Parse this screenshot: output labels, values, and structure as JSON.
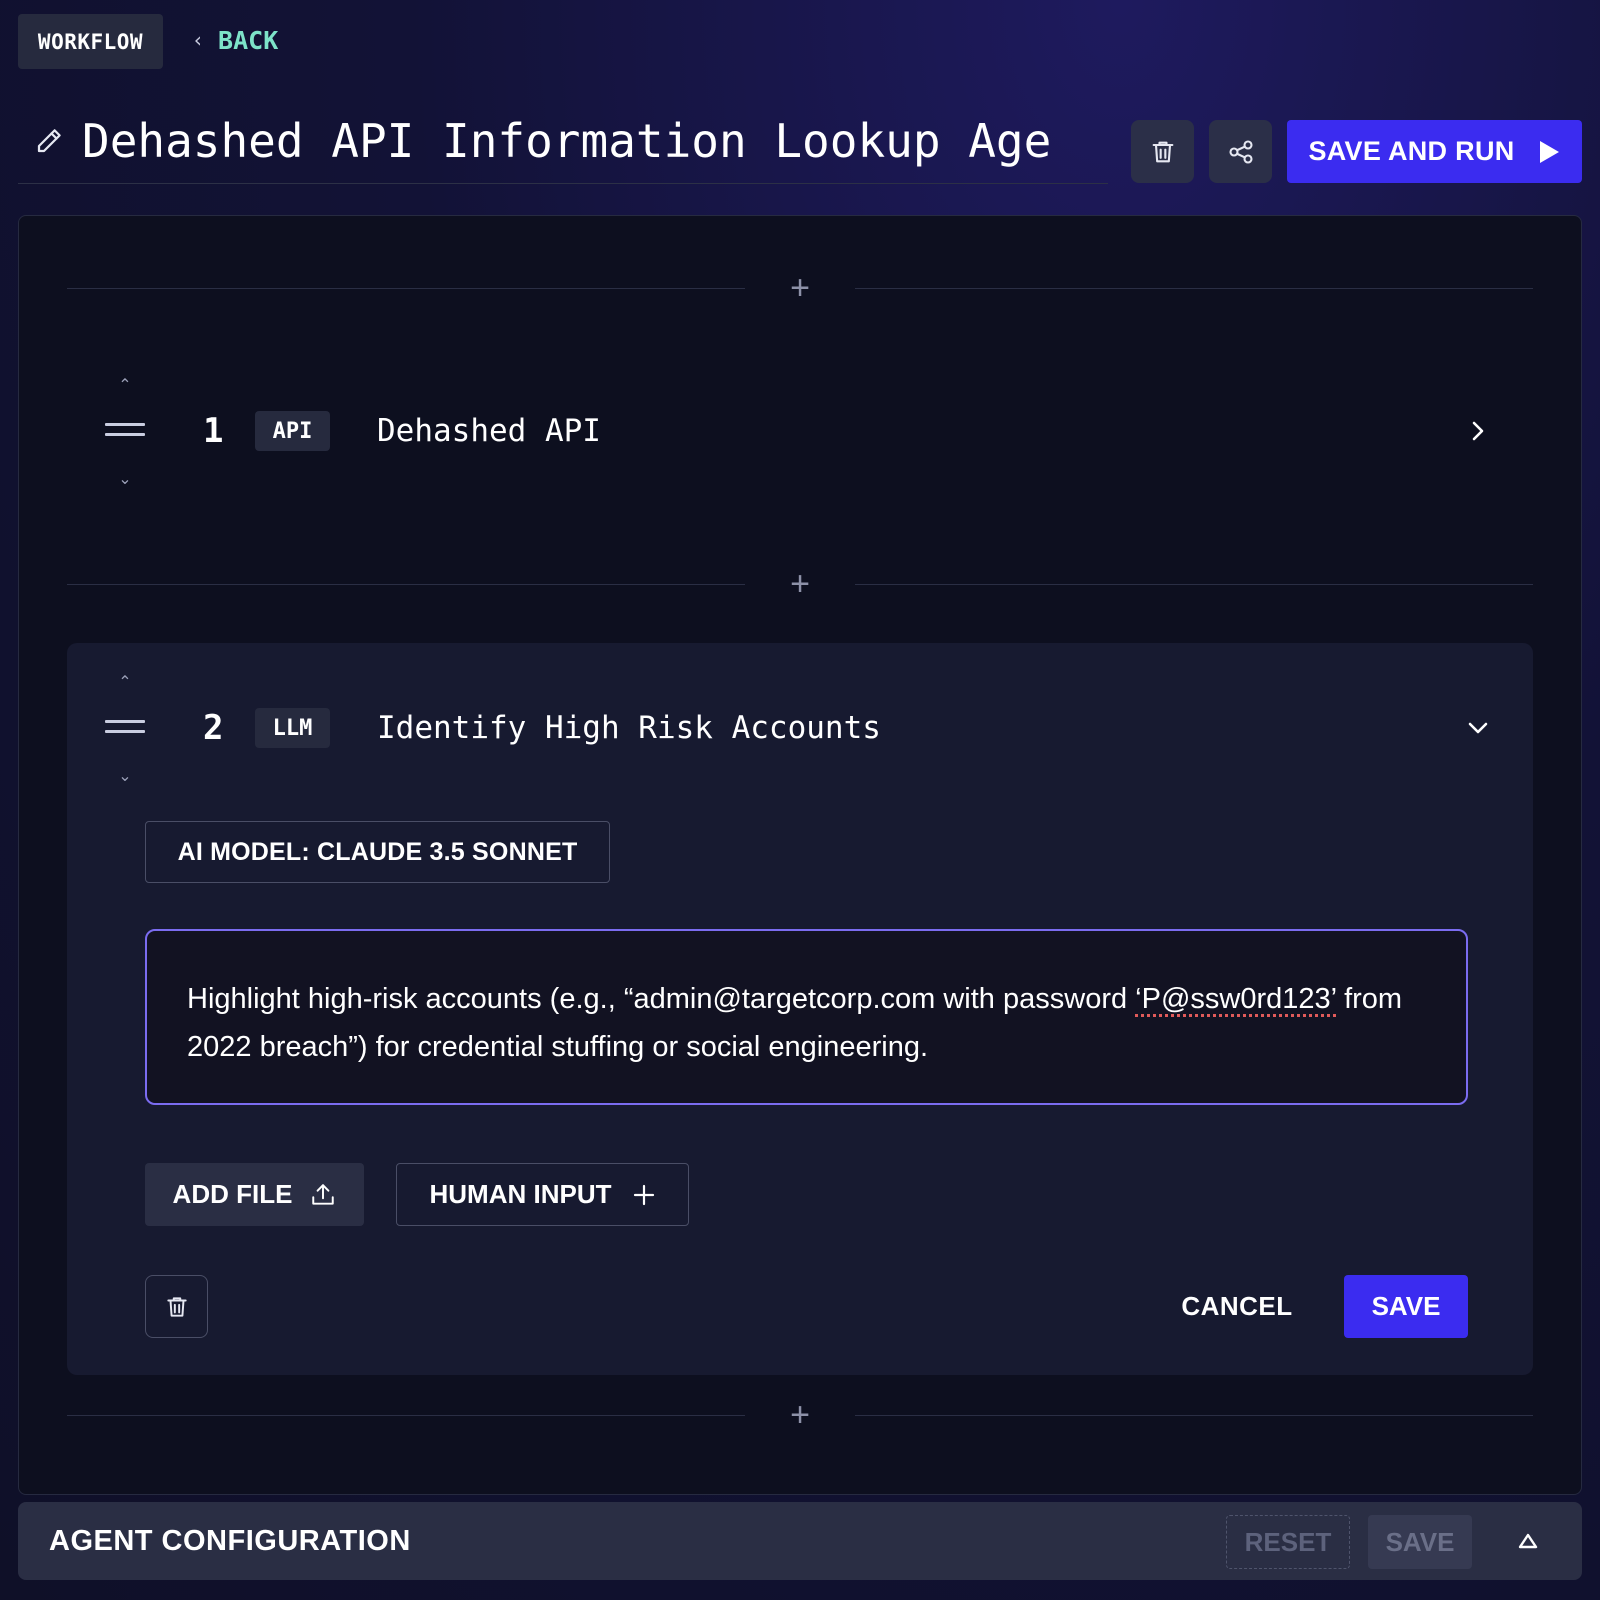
{
  "nav": {
    "badge": "WORKFLOW",
    "back_label": "BACK"
  },
  "header": {
    "title": "Dehashed API Information Lookup Age",
    "save_and_run_label": "SAVE AND RUN"
  },
  "steps": [
    {
      "number": "1",
      "type": "API",
      "name": "Dehashed API",
      "expanded": false
    },
    {
      "number": "2",
      "type": "LLM",
      "name": "Identify High Risk Accounts",
      "expanded": true,
      "model_label": "AI MODEL: CLAUDE 3.5 SONNET",
      "prompt": {
        "part1": "Highlight high-risk accounts (e.g., “admin@targetcorp.com with password ",
        "part2": "‘P@ssw0rd123’",
        "part3": " from 2022 breach”) for credential stuffing or social engineering."
      },
      "add_file_label": "ADD FILE",
      "human_input_label": "HUMAN INPUT",
      "cancel_label": "CANCEL",
      "save_label": "SAVE"
    }
  ],
  "agent_config": {
    "title": "AGENT CONFIGURATION",
    "reset_label": "RESET",
    "save_label": "SAVE"
  },
  "colors": {
    "accent": "#3b2cf0",
    "back_link": "#7de3c9",
    "prompt_border": "#7b6cf0",
    "panel_bg": "#0d0f1f",
    "card_bg": "#171a30"
  },
  "icons": {
    "title_edit": "pencil-icon",
    "delete": "trash-icon",
    "share": "share-icon",
    "run": "play-icon",
    "add": "plus-icon",
    "upload": "upload-icon",
    "collapse": "caret-up-icon"
  }
}
